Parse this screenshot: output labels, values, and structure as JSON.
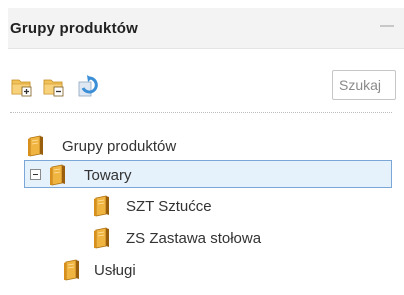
{
  "panel": {
    "title": "Grupy produktów"
  },
  "toolbar": {
    "add_group_icon": "folder-add-icon",
    "remove_group_icon": "folder-remove-icon",
    "refresh_icon": "refresh-icon",
    "search_placeholder": "Szukaj"
  },
  "tree": {
    "root": {
      "label": "Grupy produktów",
      "icon": "book-folder-icon"
    },
    "items": [
      {
        "label": "Towary",
        "expanded": true,
        "selected": true
      },
      {
        "label": "SZT Sztućce"
      },
      {
        "label": "ZS Zastawa stołowa"
      },
      {
        "label": "Usługi"
      }
    ]
  },
  "colors": {
    "selection_background": "#e5f1fb",
    "selection_border": "#7aa7d8",
    "folder_orange": "#e8a23a",
    "refresh_blue": "#3b8fd6"
  }
}
